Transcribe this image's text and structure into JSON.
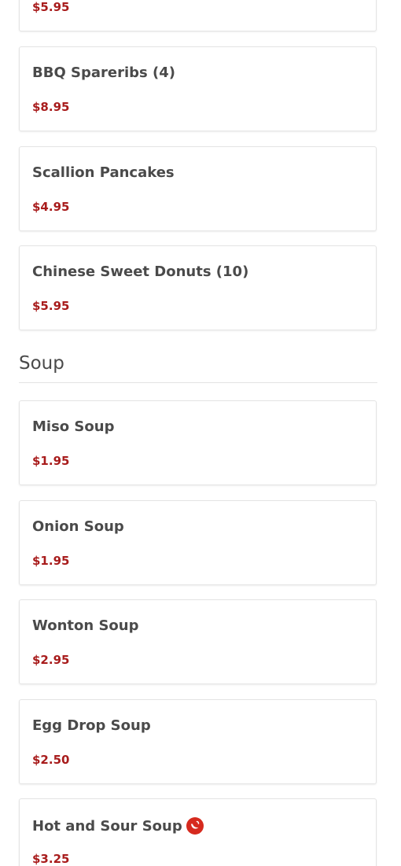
{
  "appetizers": {
    "items": [
      {
        "name": "",
        "price": "$5.95"
      },
      {
        "name": "BBQ Spareribs (4)",
        "price": "$8.95"
      },
      {
        "name": "Scallion Pancakes",
        "price": "$4.95"
      },
      {
        "name": "Chinese Sweet Donuts (10)",
        "price": "$5.95"
      }
    ]
  },
  "soup": {
    "title": "Soup",
    "items": [
      {
        "name": "Miso Soup",
        "price": "$1.95"
      },
      {
        "name": "Onion Soup",
        "price": "$1.95"
      },
      {
        "name": "Wonton Soup",
        "price": "$2.95"
      },
      {
        "name": "Egg Drop Soup",
        "price": "$2.50"
      },
      {
        "name": "Hot and Sour Soup",
        "price": "$3.25",
        "spicy_icon": "spicy-pepper-icon"
      }
    ]
  },
  "colors": {
    "price": "#a81c1c",
    "spicy_badge": "#d62a1e",
    "text": "#4a4a4a",
    "border": "#e4e4e4"
  }
}
